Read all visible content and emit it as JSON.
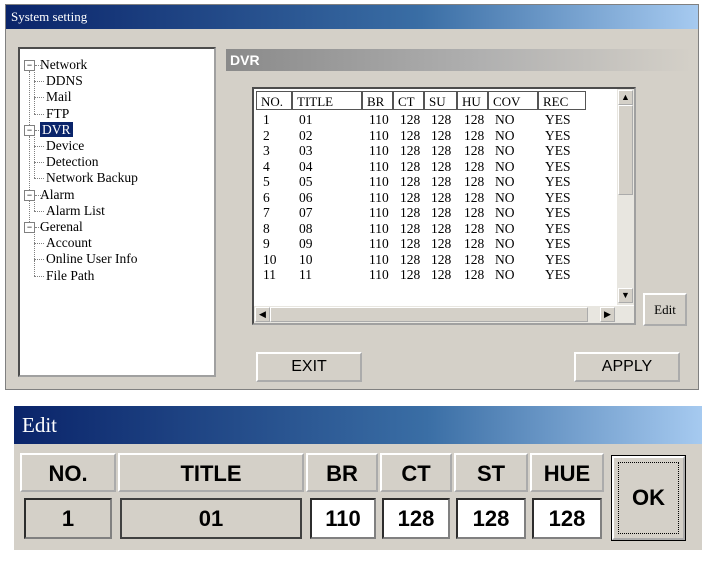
{
  "system_window": {
    "title": "System setting"
  },
  "tree": [
    {
      "label": "Network",
      "level": 0,
      "expander": "−"
    },
    {
      "label": "DDNS",
      "level": 1
    },
    {
      "label": "Mail",
      "level": 1
    },
    {
      "label": "FTP",
      "level": 1
    },
    {
      "label": "DVR",
      "level": 0,
      "expander": "−",
      "selected": true
    },
    {
      "label": "Device",
      "level": 1
    },
    {
      "label": "Detection",
      "level": 1
    },
    {
      "label": "Network Backup",
      "level": 1
    },
    {
      "label": "Alarm",
      "level": 0,
      "expander": "−"
    },
    {
      "label": "Alarm List",
      "level": 1
    },
    {
      "label": "Gerenal",
      "level": 0,
      "expander": "−"
    },
    {
      "label": "Account",
      "level": 1
    },
    {
      "label": "Online User Info",
      "level": 1
    },
    {
      "label": "File Path",
      "level": 1
    }
  ],
  "panel": {
    "title": "DVR"
  },
  "table": {
    "columns": [
      "NO.",
      "TITLE",
      "BR",
      "CT",
      "SU",
      "HU",
      "COV",
      "REC"
    ],
    "rows": [
      [
        "1",
        "01",
        "110",
        "128",
        "128",
        "128",
        "NO",
        "YES"
      ],
      [
        "2",
        "02",
        "110",
        "128",
        "128",
        "128",
        "NO",
        "YES"
      ],
      [
        "3",
        "03",
        "110",
        "128",
        "128",
        "128",
        "NO",
        "YES"
      ],
      [
        "4",
        "04",
        "110",
        "128",
        "128",
        "128",
        "NO",
        "YES"
      ],
      [
        "5",
        "05",
        "110",
        "128",
        "128",
        "128",
        "NO",
        "YES"
      ],
      [
        "6",
        "06",
        "110",
        "128",
        "128",
        "128",
        "NO",
        "YES"
      ],
      [
        "7",
        "07",
        "110",
        "128",
        "128",
        "128",
        "NO",
        "YES"
      ],
      [
        "8",
        "08",
        "110",
        "128",
        "128",
        "128",
        "NO",
        "YES"
      ],
      [
        "9",
        "09",
        "110",
        "128",
        "128",
        "128",
        "NO",
        "YES"
      ],
      [
        "10",
        "10",
        "110",
        "128",
        "128",
        "128",
        "NO",
        "YES"
      ],
      [
        "11",
        "11",
        "110",
        "128",
        "128",
        "128",
        "NO",
        "YES"
      ]
    ]
  },
  "buttons": {
    "edit": "Edit",
    "exit": "EXIT",
    "apply": "APPLY"
  },
  "edit_window": {
    "title": "Edit",
    "headers": {
      "no": "NO.",
      "title": "TITLE",
      "br": "BR",
      "ct": "CT",
      "st": "ST",
      "hue": "HUE"
    },
    "values": {
      "no": "1",
      "title": "01",
      "br": "110",
      "ct": "128",
      "st": "128",
      "hue": "128"
    },
    "ok": "OK"
  },
  "colors": {
    "titlebar": "#0a246a",
    "face": "#d4d0c8",
    "selection": "#0a246a"
  },
  "icons": [
    "minus-expander-icon",
    "scroll-up-arrow-icon",
    "scroll-down-arrow-icon",
    "scroll-left-arrow-icon",
    "scroll-right-arrow-icon"
  ]
}
